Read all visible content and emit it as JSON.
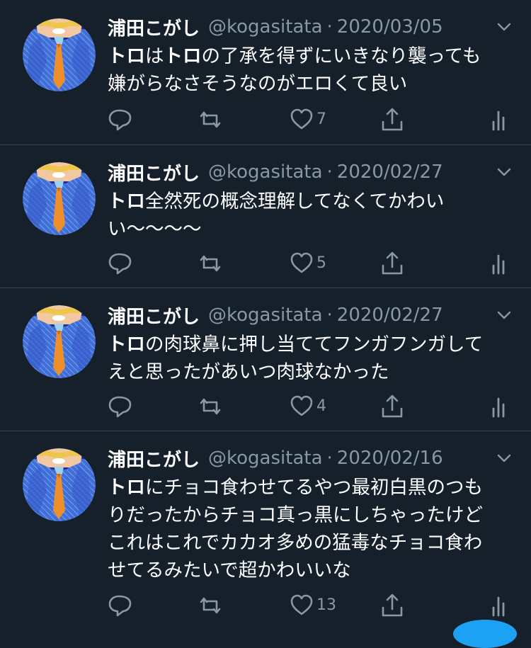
{
  "tweets": [
    {
      "name": "浦田こがし",
      "handle": "@kogasitata",
      "separator": "·",
      "date": "2020/03/05",
      "lines": [
        [
          {
            "t": "トロ",
            "b": true
          },
          {
            "t": "は",
            "b": false
          },
          {
            "t": "トロ",
            "b": true
          },
          {
            "t": "の了承を得ずにいきなり襲っても",
            "b": false
          }
        ],
        [
          {
            "t": "嫌がらなさそうなのがエロくて良い",
            "b": false
          }
        ]
      ],
      "likes": "7"
    },
    {
      "name": "浦田こがし",
      "handle": "@kogasitata",
      "separator": "·",
      "date": "2020/02/27",
      "lines": [
        [
          {
            "t": "トロ",
            "b": true
          },
          {
            "t": "全然死の概念理解してなくてかわい",
            "b": false
          }
        ],
        [
          {
            "t": "い〜〜〜〜",
            "b": false
          }
        ]
      ],
      "likes": "5"
    },
    {
      "name": "浦田こがし",
      "handle": "@kogasitata",
      "separator": "·",
      "date": "2020/02/27",
      "lines": [
        [
          {
            "t": "トロ",
            "b": true
          },
          {
            "t": "の肉球鼻に押し当ててフンガフンガして",
            "b": false
          }
        ],
        [
          {
            "t": "えと思ったがあいつ肉球なかった",
            "b": false
          }
        ]
      ],
      "likes": "4"
    },
    {
      "name": "浦田こがし",
      "handle": "@kogasitata",
      "separator": "·",
      "date": "2020/02/16",
      "lines": [
        [
          {
            "t": "トロ",
            "b": true
          },
          {
            "t": "にチョコ食わせてるやつ最初白黒のつも",
            "b": false
          }
        ],
        [
          {
            "t": "りだったからチョコ真っ黒にしちゃったけど",
            "b": false
          }
        ],
        [
          {
            "t": "これはこれでカカオ多めの猛毒なチョコ食わ",
            "b": false
          }
        ],
        [
          {
            "t": "せてるみたいで超かわいいな",
            "b": false
          }
        ]
      ],
      "likes": "13"
    }
  ],
  "icons": {
    "reply": "reply-icon",
    "retweet": "retweet-icon",
    "like": "heart-icon",
    "share": "share-icon",
    "analytics": "analytics-icon",
    "menu": "chevron-down-icon"
  },
  "colors": {
    "background": "#15202b",
    "text": "#ffffff",
    "secondary": "#8899a6",
    "divider": "#38444d",
    "accent": "#1da1f2"
  }
}
